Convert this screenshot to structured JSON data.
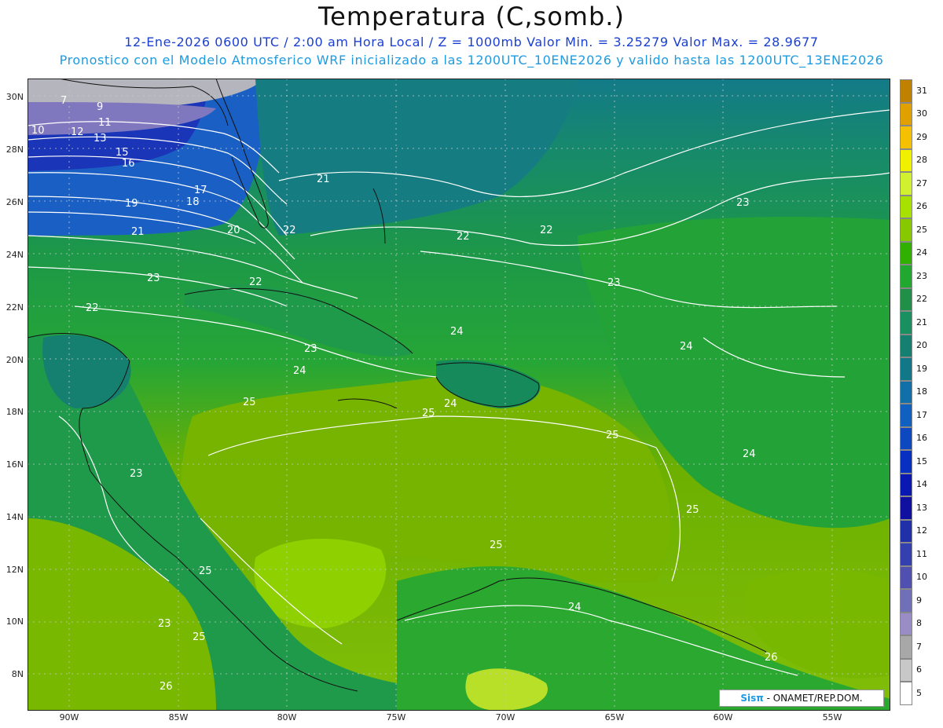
{
  "header": {
    "title": "Temperatura (C,somb.)",
    "line1": "12-Ene-2026  0600 UTC / 2:00 am Hora Local / Z = 1000mb   Valor Min. = 3.25279  Valor Max. = 28.9677",
    "line2": "Pronostico con el Modelo Atmosferico WRF inicializado a las 1200UTC_10ENE2026 y valido hasta las  1200UTC_13ENE2026"
  },
  "map": {
    "lat_ticks": [
      "30N",
      "28N",
      "26N",
      "24N",
      "22N",
      "20N",
      "18N",
      "16N",
      "14N",
      "12N",
      "10N",
      "8N"
    ],
    "lon_ticks": [
      "90W",
      "85W",
      "80W",
      "75W",
      "70W",
      "65W",
      "60W",
      "55W"
    ],
    "contour_labels": [
      "7",
      "9",
      "10",
      "11",
      "12",
      "13",
      "15",
      "16",
      "17",
      "18",
      "19",
      "20",
      "21",
      "21",
      "22",
      "22",
      "22",
      "22",
      "22",
      "23",
      "23",
      "23",
      "23",
      "23",
      "23",
      "24",
      "24",
      "24",
      "24",
      "24",
      "24",
      "25",
      "25",
      "25",
      "25",
      "25",
      "25",
      "25",
      "26",
      "26"
    ]
  },
  "legend": {
    "levels": [
      "31",
      "30",
      "29",
      "28",
      "27",
      "26",
      "25",
      "24",
      "23",
      "22",
      "21",
      "20",
      "19",
      "18",
      "17",
      "16",
      "15",
      "14",
      "13",
      "12",
      "11",
      "10",
      "9",
      "8",
      "7",
      "6",
      "5"
    ],
    "colors": [
      "#c08000",
      "#e0a000",
      "#f5c000",
      "#f0f000",
      "#d0f030",
      "#a8e000",
      "#88c800",
      "#30b000",
      "#20a830",
      "#209048",
      "#189060",
      "#168070",
      "#117888",
      "#1270a8",
      "#1060c0",
      "#0e48c0",
      "#0830c0",
      "#0818b0",
      "#1010a0",
      "#2030a8",
      "#3440b0",
      "#5050b0",
      "#7070b8",
      "#9a8cc4",
      "#a8a8a8",
      "#c8c8c8",
      "#ffffff"
    ]
  },
  "credit": {
    "sis": "Sisπ",
    "text": "- ONAMET/REP.DOM."
  }
}
